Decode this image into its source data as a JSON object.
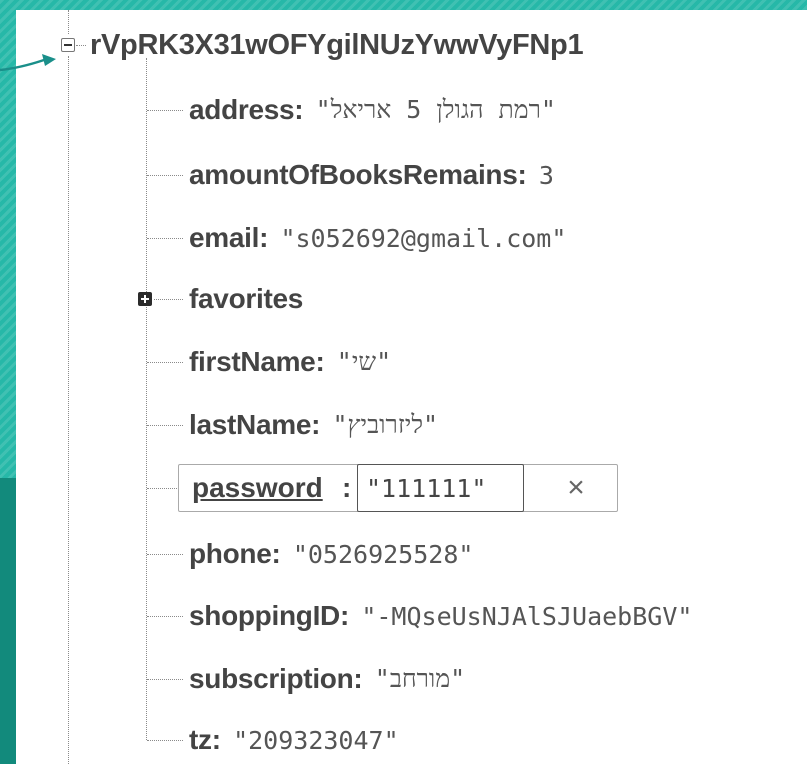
{
  "root": {
    "key": "rVpRK3X31wOFYgilNUzYwwVyFNp1"
  },
  "fields": {
    "address": {
      "key": "address",
      "value": "\"רמת הגולן 5 אריאל\""
    },
    "amount": {
      "key": "amountOfBooksRemains",
      "value": "3"
    },
    "email": {
      "key": "email",
      "value": "\"s052692@gmail.com\""
    },
    "favorites": {
      "key": "favorites"
    },
    "firstName": {
      "key": "firstName",
      "value": "\"שי\""
    },
    "lastName": {
      "key": "lastName",
      "value": "\"ליזרוביץ\""
    },
    "password": {
      "key": "password",
      "value": "\"111111\""
    },
    "phone": {
      "key": "phone",
      "value": "\"0526925528\""
    },
    "shopping": {
      "key": "shoppingID",
      "value": "\"-MQseUsNJAlSJUaebBGV\""
    },
    "subscription": {
      "key": "subscription",
      "value": "\"מורחב\""
    },
    "tz": {
      "key": "tz",
      "value": "\"209323047\""
    }
  },
  "edit": {
    "close_label": "×"
  },
  "icons": {
    "collapse": "minus-box-icon",
    "expand": "plus-box-icon",
    "pointer": "arrow-right-icon",
    "close": "close-icon"
  },
  "colors": {
    "frame": "#26b8a8",
    "frame_dark": "#128a7c",
    "key_text": "#444444",
    "value_text": "#555555",
    "arrow": "#1a8f8a"
  }
}
